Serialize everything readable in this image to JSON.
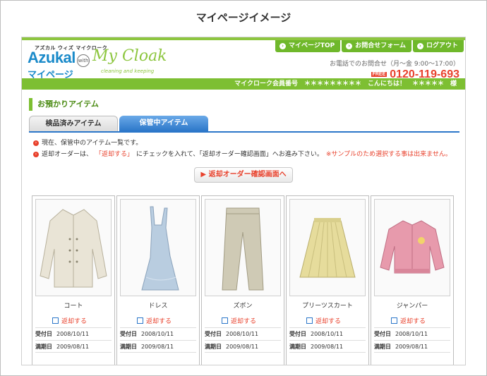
{
  "page_title": "マイページイメージ",
  "logo": {
    "ruby": "アズカル ウィズ マイクローク",
    "azukal": "Azukal",
    "with": "with",
    "mycloak": "My Cloak",
    "tagline": "cleaning and keeping",
    "mypage": "マイページ"
  },
  "nav": [
    {
      "label": "マイページTOP",
      "icon": "arrow-circle-icon"
    },
    {
      "label": "お問合せフォーム",
      "icon": "arrow-circle-icon"
    },
    {
      "label": "ログアウト",
      "icon": "arrow-circle-icon"
    }
  ],
  "contact": {
    "hours": "お電話でのお問合せ（月〜金 9:00〜17:00）",
    "free_badge": "FREE",
    "tel": "0120-119-693"
  },
  "member_bar": "マイクローク会員番号　＊＊＊＊＊＊＊＊＊　こんにちは！　＊＊＊＊＊　様",
  "section_title": "お預かりアイテム",
  "tabs": [
    {
      "label": "検品済みアイテム",
      "active": false
    },
    {
      "label": "保管中アイテム",
      "active": true
    }
  ],
  "notes": {
    "line1": "現在、保管中のアイテム一覧です。",
    "line2_a": "返却オーダーは、",
    "line2_b": "「返却する」",
    "line2_c": "にチェックを入れて、「返却オーダー確認画面」へお進み下さい。",
    "line2_d": "※サンプルのため選択する事は出来ません。"
  },
  "cta_label": "▶ 返却オーダー確認画面へ",
  "items": [
    {
      "name": "コート",
      "return_label": "返却する",
      "received_label": "受付日",
      "received": "2008/10/11",
      "expiry_label": "満期日",
      "expiry": "2009/08/11",
      "color": "#e9e4d6"
    },
    {
      "name": "ドレス",
      "return_label": "返却する",
      "received_label": "受付日",
      "received": "2008/10/11",
      "expiry_label": "満期日",
      "expiry": "2009/08/11",
      "color": "#b9cde0"
    },
    {
      "name": "ズボン",
      "return_label": "返却する",
      "received_label": "受付日",
      "received": "2008/10/11",
      "expiry_label": "満期日",
      "expiry": "2009/08/11",
      "color": "#cfcab5"
    },
    {
      "name": "プリーツスカート",
      "return_label": "返却する",
      "received_label": "受付日",
      "received": "2008/10/11",
      "expiry_label": "満期日",
      "expiry": "2009/08/11",
      "color": "#e6dc9c"
    },
    {
      "name": "ジャンパー",
      "return_label": "返却する",
      "received_label": "受付日",
      "received": "2008/10/11",
      "expiry_label": "満期日",
      "expiry": "2009/08/11",
      "color": "#e79aac"
    }
  ]
}
